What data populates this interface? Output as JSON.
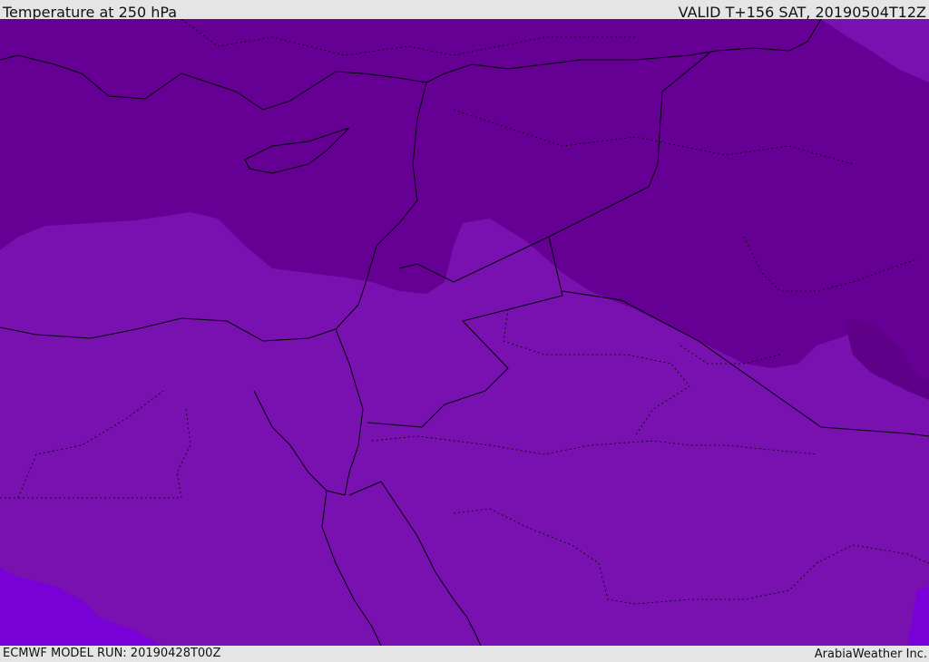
{
  "header": {
    "title": "Temperature at 250 hPa",
    "valid": "VALID T+156 SAT, 20190504T12Z"
  },
  "footer": {
    "model_run": "ECMWF MODEL RUN: 20190428T00Z",
    "brand": "ArabiaWeather Inc."
  },
  "colors": {
    "cold_band": "#660095",
    "mid_band": "#7811b0",
    "warm_band": "#7a00d8",
    "border": "#000000"
  }
}
